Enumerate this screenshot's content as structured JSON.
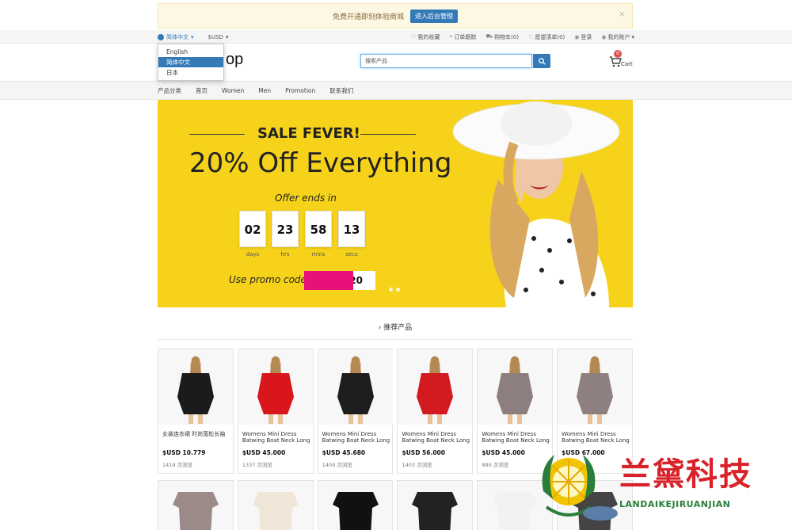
{
  "notice": {
    "text": "免费开通即刻体验商城",
    "button": "进入后台管理",
    "close": "×"
  },
  "topbar": {
    "language": "简体中文",
    "currency": "$USD",
    "links": [
      "我的收藏",
      "订单跟踪",
      "购物车(0)",
      "愿望清单(0)",
      "登录",
      "我的账户"
    ]
  },
  "language_menu": {
    "items": [
      {
        "label": "English",
        "active": false
      },
      {
        "label": "简体中文",
        "active": true
      },
      {
        "label": "日本",
        "active": false
      }
    ]
  },
  "header": {
    "logo": "op",
    "search_placeholder": "搜索产品",
    "cart_count": "0",
    "cart_label": "Cart"
  },
  "categories": [
    "产品分类",
    "首页",
    "Women",
    "Men",
    "Promotion",
    "联系我们"
  ],
  "banner": {
    "title": "SALE FEVER!",
    "subtitle": "20% Off Everything",
    "offer_text": "Offer ends in",
    "countdown": [
      {
        "value": "02",
        "label": "days"
      },
      {
        "value": "23",
        "label": "hrs"
      },
      {
        "value": "58",
        "label": "mins"
      },
      {
        "value": "13",
        "label": "secs"
      }
    ],
    "promo_label": "Use promo code",
    "promo_code": "20"
  },
  "section": {
    "title": "推荐产品"
  },
  "products": [
    {
      "name": "女装连衣裙 时尚宽松长袖",
      "price": "$USD 10.779",
      "sold": "1419 次浏览",
      "color": "#1b1b1b"
    },
    {
      "name": "Womens Mini Dress Batwing Boat Neck Long",
      "price": "$USD 45.000",
      "sold": "1337 次浏览",
      "color": "#d8161c"
    },
    {
      "name": "Womens Mini Dress Batwing Boat Neck Long",
      "price": "$USD 45.680",
      "sold": "1409 次浏览",
      "color": "#1e1e1e"
    },
    {
      "name": "Womens Mini Dress Batwing Boat Neck Long",
      "price": "$USD 56.000",
      "sold": "1403 次浏览",
      "color": "#d21a20"
    },
    {
      "name": "Womens Mini Dress Batwing Boat Neck Long",
      "price": "$USD 45.000",
      "sold": "890 次浏览",
      "color": "#8e7f7f"
    },
    {
      "name": "Womens Mini Dress Batwing Boat Neck Long",
      "price": "$USD 67.000",
      "sold": "",
      "color": "#8d807f"
    }
  ],
  "products_row2": [
    "#9b8a88",
    "#efe6d8",
    "#111111",
    "#222222",
    "#f2f2f2",
    "#444444"
  ],
  "watermark": {
    "title": "兰黛科技",
    "subtitle": "LANDAIKEJIRUANJIAN"
  },
  "colors": {
    "accent": "#337ab7",
    "banner": "#f6d31a",
    "promo": "#e8117a"
  }
}
